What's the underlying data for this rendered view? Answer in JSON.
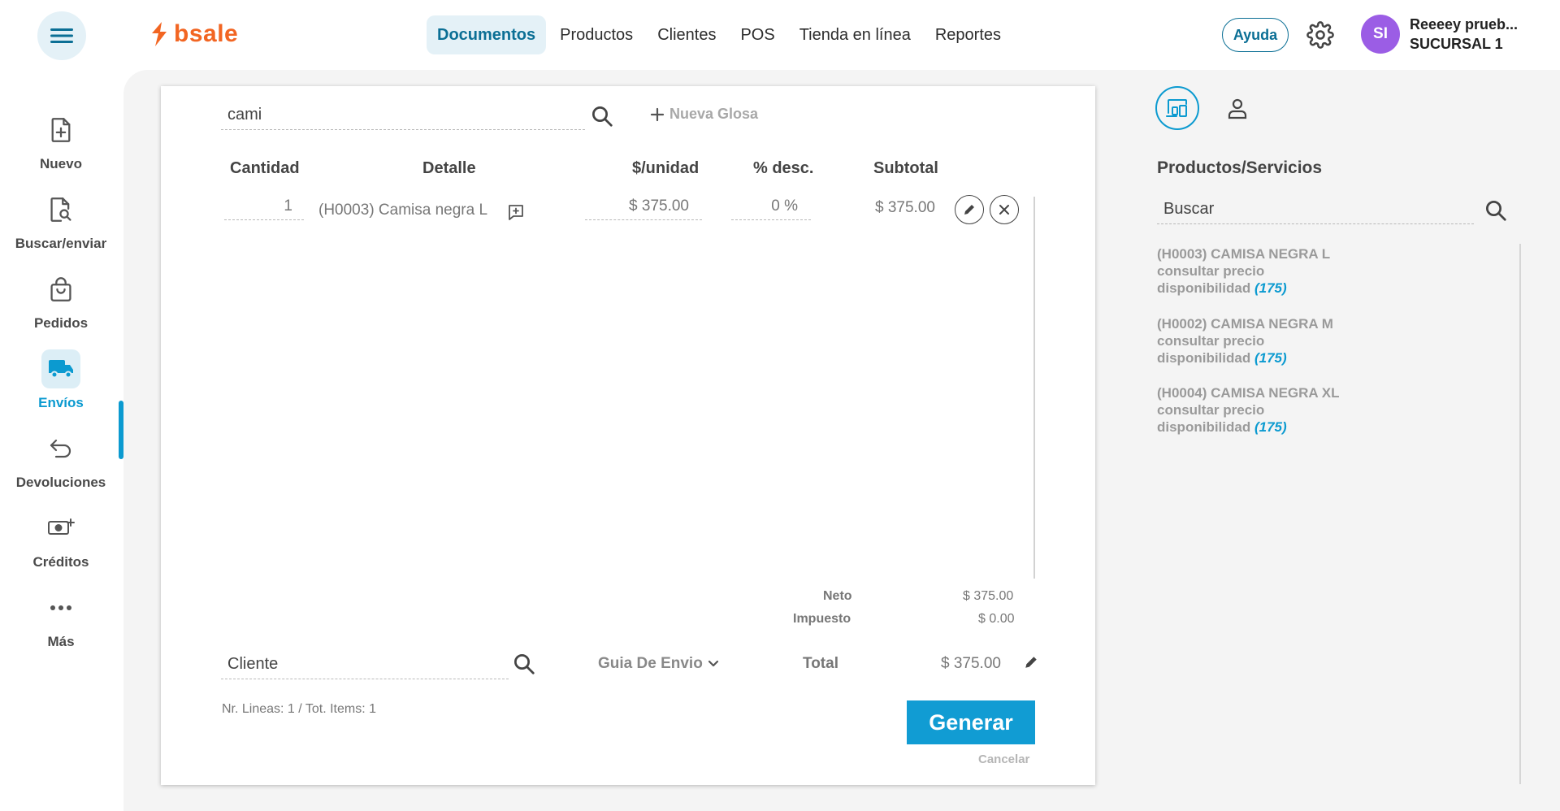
{
  "header": {
    "logo_text": "bsale",
    "nav": [
      "Documentos",
      "Productos",
      "Clientes",
      "POS",
      "Tienda en línea",
      "Reportes"
    ],
    "active_nav": "Documentos",
    "help_label": "Ayuda",
    "avatar_initials": "SI",
    "user_name": "Reeeey prueb...",
    "branch": "SUCURSAL 1"
  },
  "sidebar": {
    "items": [
      {
        "label": "Nuevo",
        "icon": "new-document-icon"
      },
      {
        "label": "Buscar/enviar",
        "icon": "search-document-icon"
      },
      {
        "label": "Pedidos",
        "icon": "shopping-bag-icon"
      },
      {
        "label": "Envíos",
        "icon": "truck-icon"
      },
      {
        "label": "Devoluciones",
        "icon": "return-arrow-icon"
      },
      {
        "label": "Créditos",
        "icon": "money-plus-icon"
      },
      {
        "label": "Más",
        "icon": "more-dots-icon"
      }
    ],
    "active": "Envíos"
  },
  "document": {
    "search_value": "cami",
    "new_glosa_label": "Nueva Glosa",
    "columns": [
      "Cantidad",
      "Detalle",
      "$/unidad",
      "% desc.",
      "Subtotal"
    ],
    "rows": [
      {
        "quantity": "1",
        "detail": "(H0003) Camisa negra L",
        "unit_price": "$ 375.00",
        "discount": "0 %",
        "subtotal": "$ 375.00"
      }
    ],
    "summary": {
      "neto_label": "Neto",
      "neto_value": "$ 375.00",
      "tax_label": "Impuesto",
      "tax_value": "$ 0.00",
      "total_label": "Total",
      "total_value": "$ 375.00"
    },
    "client_placeholder": "Cliente",
    "doc_type": "Guia De Envio",
    "counts": "Nr. Lineas: 1 / Tot. Items: 1",
    "generate_label": "Generar",
    "cancel_label": "Cancelar"
  },
  "right_panel": {
    "title": "Productos/Servicios",
    "search_placeholder": "Buscar",
    "products": [
      {
        "name": "(H0003) CAMISA NEGRA L",
        "price": "consultar precio",
        "availability_label": "disponibilidad",
        "availability": "(175)"
      },
      {
        "name": "(H0002) CAMISA NEGRA M",
        "price": "consultar precio",
        "availability_label": "disponibilidad",
        "availability": "(175)"
      },
      {
        "name": "(H0004) CAMISA NEGRA XL",
        "price": "consultar precio",
        "availability_label": "disponibilidad",
        "availability": "(175)"
      }
    ]
  },
  "colors": {
    "brand": "#f26522",
    "accent": "#0b9ad0",
    "primary_button": "#119cd3",
    "nav_active_bg": "#e4f1f7",
    "avatar": "#9b5de5"
  }
}
